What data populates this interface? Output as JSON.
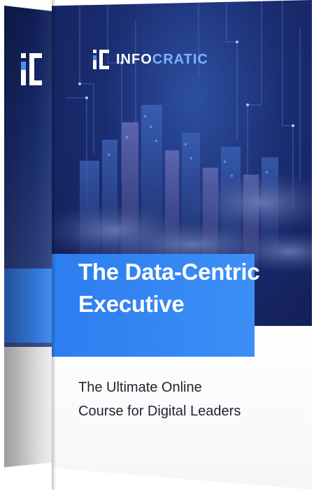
{
  "brand": {
    "name_part1": "INFO",
    "name_part2": "CRATIC",
    "logo_icon": "infocratic-logo-icon"
  },
  "product": {
    "title_line1": "The Data-Centric",
    "title_line2": "Executive",
    "subtitle_line1": "The Ultimate Online",
    "subtitle_line2": "Course for Digital Leaders"
  },
  "colors": {
    "box_navy": "#111c52",
    "accent_blue": "#3c8ff5",
    "brand_accent": "#7fb0ff",
    "text_dark": "#1f2430"
  }
}
